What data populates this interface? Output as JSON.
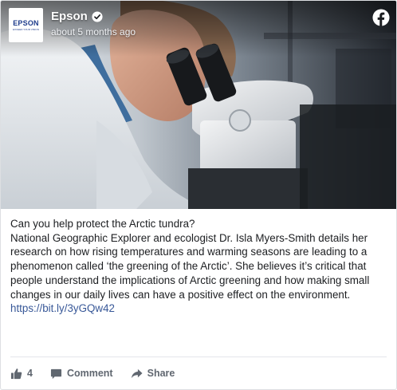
{
  "page": {
    "name": "Epson",
    "time": "about 5 months ago",
    "logo_word": "EPSON",
    "logo_tagline": "EXCEED YOUR VISION"
  },
  "post": {
    "headline": "Can you help protect the Arctic tundra?",
    "body": "National Geographic Explorer and ecologist Dr. Isla Myers-Smith details her research on how rising temperatures and warming seasons are leading to a phenomenon called ‘the greening of the Arctic’. She believes it’s critical that people understand the implications of Arctic greening and how making small changes in our daily lives can have a positive effect on the environment.",
    "link": "https://bit.ly/3yGQw42"
  },
  "actions": {
    "like_count": "4",
    "comment_label": "Comment",
    "share_label": "Share"
  },
  "icons": {
    "verified": "verified-badge-icon",
    "facebook": "facebook-icon",
    "like": "thumbs-up-icon",
    "comment": "comment-bubble-icon",
    "share": "share-arrow-icon"
  },
  "colors": {
    "link": "#385898",
    "action_gray": "#606770",
    "logo_blue": "#1e3c8c"
  }
}
